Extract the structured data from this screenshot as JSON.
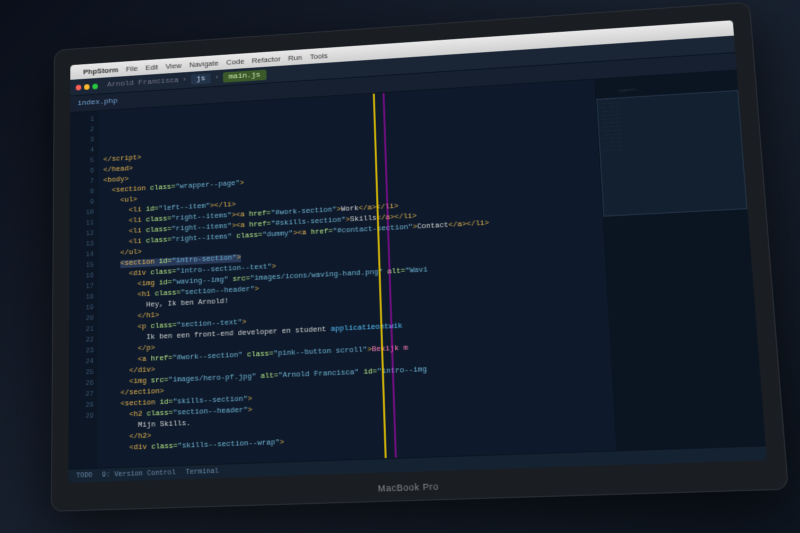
{
  "brand": "MacBook Pro",
  "menubar": {
    "apple": "",
    "app": "PhpStorm",
    "items": [
      "File",
      "Edit",
      "View",
      "Navigate",
      "Code",
      "Refactor",
      "Run",
      "Tools"
    ]
  },
  "breadcrumb": {
    "project": "Arnold Francisca",
    "path": [
      "js",
      "main.js"
    ]
  },
  "tabs": {
    "active": "index.php"
  },
  "statusbar": {
    "items": [
      "TODO",
      "9: Version Control",
      "Terminal"
    ]
  },
  "code": {
    "lines": [
      {
        "i": 1,
        "html": "<span class='t-tag'>&lt;/script&gt;</span>"
      },
      {
        "i": 2,
        "html": "<span class='t-tag'>&lt;/head&gt;</span>"
      },
      {
        "i": 3,
        "html": "<span class='t-tag'>&lt;body&gt;</span>"
      },
      {
        "i": 4,
        "html": "  <span class='t-tag'>&lt;section</span> <span class='t-attr'>class=</span><span class='t-str'>\"wrapper--page\"</span><span class='t-tag'>&gt;</span>"
      },
      {
        "i": 5,
        "html": "    <span class='t-tag'>&lt;ul&gt;</span>"
      },
      {
        "i": 6,
        "html": "      <span class='t-tag'>&lt;li</span> <span class='t-attr'>id=</span><span class='t-str'>\"left--item\"</span><span class='t-tag'>&gt;&lt;/li&gt;</span>"
      },
      {
        "i": 7,
        "html": "      <span class='t-tag'>&lt;li</span> <span class='t-attr'>class=</span><span class='t-str'>\"right--items\"</span><span class='t-tag'>&gt;&lt;a</span> <span class='t-attr'>href=</span><span class='t-str'>\"#work-section\"</span><span class='t-tag'>&gt;</span><span class='t-txt'>Work</span><span class='t-tag'>&lt;/a&gt;&lt;/li&gt;</span>"
      },
      {
        "i": 8,
        "html": "      <span class='t-tag'>&lt;li</span> <span class='t-attr'>class=</span><span class='t-str'>\"right--items\"</span><span class='t-tag'>&gt;&lt;a</span> <span class='t-attr'>href=</span><span class='t-str'>\"#skills-section\"</span><span class='t-tag'>&gt;</span><span class='t-txt'>Skills</span><span class='t-tag'>&lt;/a&gt;&lt;/li&gt;</span>"
      },
      {
        "i": 9,
        "html": "      <span class='t-tag'>&lt;li</span> <span class='t-attr'>class=</span><span class='t-str'>\"right--items\"</span> <span class='t-attr'>class=</span><span class='t-str'>\"dummy\"</span><span class='t-tag'>&gt;&lt;a</span> <span class='t-attr'>href=</span><span class='t-str'>\"#contact-section\"</span><span class='t-tag'>&gt;</span><span class='t-txt'>Contact</span><span class='t-tag'>&lt;/a&gt;&lt;/li&gt;</span>"
      },
      {
        "i": 10,
        "html": "    <span class='t-tag'>&lt;/ul&gt;</span>"
      },
      {
        "i": 11,
        "html": ""
      },
      {
        "i": 12,
        "html": "    <span class='hl'><span class='t-tag'>&lt;section</span> <span class='t-attr'>id=</span><span class='t-str'>\"intro-section\"</span><span class='t-tag'>&gt;</span></span>"
      },
      {
        "i": 13,
        "html": "      <span class='t-tag'>&lt;div</span> <span class='t-attr'>class=</span><span class='t-str'>\"intro--section--text\"</span><span class='t-tag'>&gt;</span>"
      },
      {
        "i": 14,
        "html": "        <span class='t-tag'>&lt;img</span> <span class='t-attr'>id=</span><span class='t-str'>\"waving--img\"</span> <span class='t-attr'>src=</span><span class='t-str'>\"images/icons/waving-hand.png\"</span> <span class='t-attr'>alt=</span><span class='t-str'>\"Wavi</span>"
      },
      {
        "i": 15,
        "html": "        <span class='t-tag'>&lt;h1</span> <span class='t-attr'>class=</span><span class='t-str'>\"section--header\"</span><span class='t-tag'>&gt;</span>"
      },
      {
        "i": 16,
        "html": "          <span class='t-txt'>Hey, Ik ben Arnold!</span>"
      },
      {
        "i": 17,
        "html": "        <span class='t-tag'>&lt;/h1&gt;</span>"
      },
      {
        "i": 18,
        "html": "        <span class='t-tag'>&lt;p</span> <span class='t-attr'>class=</span><span class='t-str'>\"section--text\"</span><span class='t-tag'>&gt;</span>"
      },
      {
        "i": 19,
        "html": "          <span class='t-txt'>Ik ben een front-end developer en student </span><span class='t-sel'>applicatieontwik</span>"
      },
      {
        "i": 20,
        "html": "        <span class='t-tag'>&lt;/p&gt;</span>"
      },
      {
        "i": 21,
        "html": "        <span class='t-tag'>&lt;a</span> <span class='t-attr'>href=</span><span class='t-str'>\"#work--section\"</span> <span class='t-attr'>class=</span><span class='t-str'>\"pink--button scroll\"</span><span class='t-tag'>&gt;</span><span class='t-pink'>Bekijk m</span>"
      },
      {
        "i": 22,
        "html": "      <span class='t-tag'>&lt;/div&gt;</span>"
      },
      {
        "i": 23,
        "html": "      <span class='t-tag'>&lt;img</span> <span class='t-attr'>src=</span><span class='t-str'>\"images/hero-pf.jpg\"</span> <span class='t-attr'>alt=</span><span class='t-str'>\"Arnold Francisca\"</span> <span class='t-attr'>id=</span><span class='t-str'>\"intro--img</span>"
      },
      {
        "i": 24,
        "html": "    <span class='t-tag'>&lt;/section&gt;</span>"
      },
      {
        "i": 25,
        "html": "    <span class='t-tag'>&lt;section</span> <span class='t-attr'>id=</span><span class='t-str'>\"skills--section\"</span><span class='t-tag'>&gt;</span>"
      },
      {
        "i": 26,
        "html": "      <span class='t-tag'>&lt;h2</span> <span class='t-attr'>class=</span><span class='t-str'>\"section--header\"</span><span class='t-tag'>&gt;</span>"
      },
      {
        "i": 27,
        "html": "        <span class='t-txt'>Mijn Skills.</span>"
      },
      {
        "i": 28,
        "html": "      <span class='t-tag'>&lt;/h2&gt;</span>"
      },
      {
        "i": 29,
        "html": "      <span class='t-tag'>&lt;div</span> <span class='t-attr'>class=</span><span class='t-str'>\"skills--section--wrap\"</span><span class='t-tag'>&gt;</span>"
      }
    ],
    "minimap_hint": "suggested ▸\n\n— ——— ———\n —— —— ———\n——— ——— ——\n ——— —— ——\n—— ——— ———\n——— —— ———\n —— ——— ——\n——— ——— ——\n—— —— ————\n ——— —— ——\n——— ——— ——\n—— ——— ———\n ——— —— ——\n——— —— ———"
  }
}
